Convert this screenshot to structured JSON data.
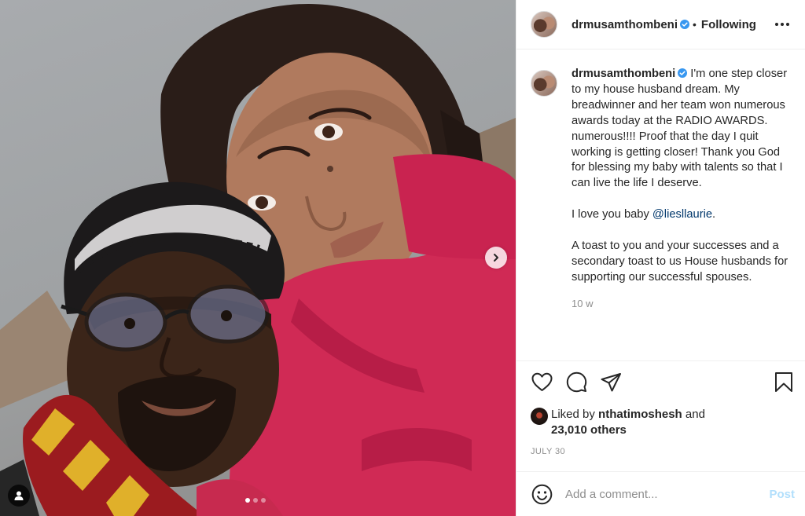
{
  "post": {
    "author": "drmusamthombeni",
    "header_separator": "•",
    "follow_status": "Following",
    "photo_alt": "Selfie photo",
    "caption": {
      "p1": " I'm one step closer to my house husband dream. My breadwinner and her team won numerous awards today at the RADIO AWARDS. numerous!!!! Proof that the day I quit working is getting closer! Thank you God for blessing my baby with talents so that I can live the life I deserve.",
      "p2_text": "I love you baby ",
      "p2_mention": "@liesllaurie",
      "p2_end": ".",
      "p3": "A toast to you and your successes and a secondary toast to us House husbands for supporting our successful spouses."
    },
    "time_ago": "10 w",
    "likes": {
      "prefix": "Liked by ",
      "user": "nthatimoshesh",
      "mid": " and",
      "count": "23,010 others"
    },
    "date": "JULY 30",
    "carousel": {
      "total": 3,
      "active": 1
    }
  },
  "comment_box": {
    "placeholder": "Add a comment...",
    "post_label": "Post"
  },
  "icons": {
    "verified": "verified-badge-icon",
    "more": "more-options-icon",
    "like": "heart-icon",
    "comment": "comment-bubble-icon",
    "share": "paper-plane-icon",
    "save": "bookmark-icon",
    "emoji": "emoji-smiley-icon",
    "next": "chevron-right-icon",
    "tags": "user-tag-icon"
  },
  "colors": {
    "verified_blue": "#3897f0",
    "mention": "#00376b",
    "post_disabled": "#b2dffc",
    "muted": "#8e8e8e"
  }
}
